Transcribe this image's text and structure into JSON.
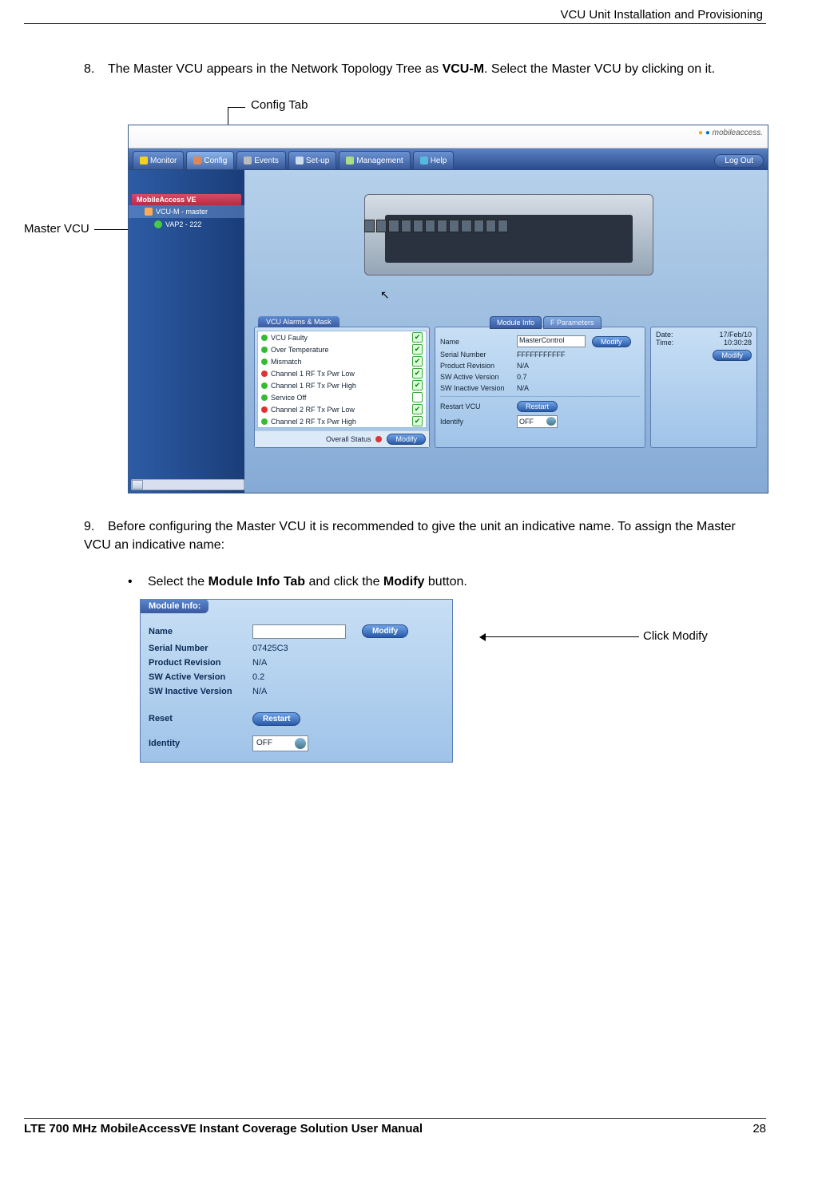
{
  "header_text": "VCU Unit Installation and Provisioning",
  "step8": {
    "num": "8.",
    "text_a": "The Master VCU appears in the Network Topology Tree as ",
    "text_b": "VCU-M",
    "text_c": ". Select the Master VCU by clicking on it."
  },
  "annot": {
    "config_tab": "Config Tab",
    "master_vcu": "Master VCU",
    "click_modify": "Click Modify"
  },
  "app": {
    "brand": "mobileaccess.",
    "tabs": [
      "Monitor",
      "Config",
      "Events",
      "Set-up",
      "Management",
      "Help"
    ],
    "logout": "Log Out",
    "tree_header": "MobileAccess VE",
    "tree_items": [
      {
        "label": "VCU-M - master",
        "selected": true,
        "icon": "orange"
      },
      {
        "label": "VAP2 - 222",
        "selected": false,
        "icon": "green"
      }
    ],
    "alarms_panel_title": "VCU Alarms & Mask",
    "alarms": [
      {
        "color": "green",
        "label": "VCU Faulty",
        "checked": true
      },
      {
        "color": "green",
        "label": "Over Temperature",
        "checked": true
      },
      {
        "color": "green",
        "label": "Mismatch",
        "checked": true
      },
      {
        "color": "red",
        "label": "Channel 1 RF Tx Pwr Low",
        "checked": true
      },
      {
        "color": "green",
        "label": "Channel 1 RF Tx Pwr High",
        "checked": true
      },
      {
        "color": "green",
        "label": "Service Off",
        "checked": false
      },
      {
        "color": "red",
        "label": "Channel 2 RF Tx Pwr Low",
        "checked": true
      },
      {
        "color": "green",
        "label": "Channel 2 RF Tx Pwr High",
        "checked": true
      }
    ],
    "overall_status_label": "Overall Status",
    "modify_btn": "Modify",
    "module_tab_active": "Module Info",
    "module_tab_bg": "F Parameters",
    "module_rows": {
      "name_label": "Name",
      "name_value": "MasterControl",
      "serial_label": "Serial Number",
      "serial_value": "FFFFFFFFFFF",
      "rev_label": "Product Revision",
      "rev_value": "N/A",
      "sw_active_label": "SW Active Version",
      "sw_active_value": "0.7",
      "sw_inactive_label": "SW Inactive Version",
      "sw_inactive_value": "N/A",
      "restart_label": "Restart VCU",
      "restart_btn": "Restart",
      "identify_label": "Identify",
      "identify_value": "OFF"
    },
    "date_panel": {
      "date_label": "Date:",
      "date_value": "17/Feb/10",
      "time_label": "Time:",
      "time_value": "10:30:28",
      "modify_btn": "Modify"
    }
  },
  "step9": {
    "num": "9.",
    "text": "Before configuring the Master VCU it is recommended to give the unit an indicative name. To assign the Master VCU an indicative name:"
  },
  "bullet1": {
    "text_a": "Select the ",
    "text_b": "Module Info Tab",
    "text_c": " and click the ",
    "text_d": "Modify",
    "text_e": " button."
  },
  "panel2": {
    "title": "Module Info:",
    "name_label": "Name",
    "modify_btn": "Modify",
    "serial_label": "Serial Number",
    "serial_value": "07425C3",
    "rev_label": "Product Revision",
    "rev_value": "N/A",
    "swa_label": "SW Active Version",
    "swa_value": "0.2",
    "swi_label": "SW Inactive Version",
    "swi_value": "N/A",
    "reset_label": "Reset",
    "restart_btn": "Restart",
    "identity_label": "Identity",
    "identity_value": "OFF"
  },
  "footer": {
    "title": "LTE 700 MHz MobileAccessVE Instant Coverage Solution User Manual",
    "page": "28"
  }
}
